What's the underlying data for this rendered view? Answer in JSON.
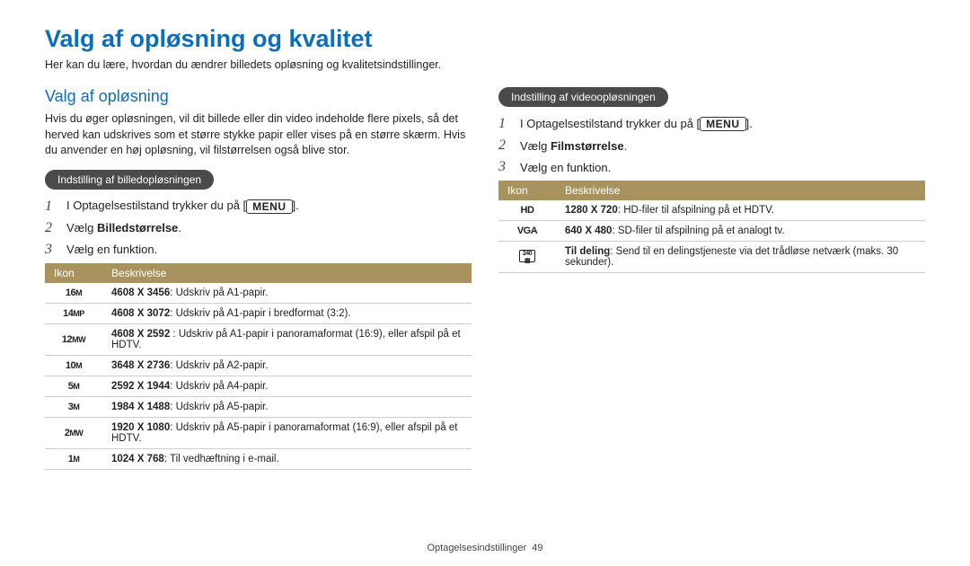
{
  "page": {
    "title": "Valg af opløsning og kvalitet",
    "intro": "Her kan du lære, hvordan du ændrer billedets opløsning og kvalitetsindstillinger."
  },
  "left": {
    "section_title": "Valg af opløsning",
    "section_body": "Hvis du øger opløsningen, vil dit billede eller din video indeholde flere pixels, så det herved kan udskrives som et større stykke papir eller vises på en større skærm. Hvis du anvender en høj opløsning, vil filstørrelsen også blive stor.",
    "pill": "Indstilling af billedopløsningen",
    "steps": [
      {
        "num": "1",
        "pre": "I Optagelsestilstand trykker du på [",
        "btn": "MENU",
        "post": "]."
      },
      {
        "num": "2",
        "pre": "Vælg ",
        "bold": "Billedstørrelse",
        "post": "."
      },
      {
        "num": "3",
        "pre": "Vælg en funktion.",
        "bold": "",
        "post": ""
      }
    ],
    "table": {
      "headers": [
        "Ikon",
        "Beskrivelse"
      ],
      "rows": [
        {
          "icon": "16M",
          "res": "4608 X 3456",
          "desc": ": Udskriv på A1-papir."
        },
        {
          "icon": "14MP",
          "res": "4608 X 3072",
          "desc": ": Udskriv på A1-papir i bredformat (3:2)."
        },
        {
          "icon": "12MW",
          "res": "4608 X 2592",
          "desc": " : Udskriv på A1-papir i panoramaformat (16:9), eller afspil på et HDTV."
        },
        {
          "icon": "10M",
          "res": "3648 X 2736",
          "desc": ": Udskriv på A2-papir."
        },
        {
          "icon": "5M",
          "res": "2592 X 1944",
          "desc": ": Udskriv på A4-papir."
        },
        {
          "icon": "3M",
          "res": "1984 X 1488",
          "desc": ": Udskriv på A5-papir."
        },
        {
          "icon": "2MW",
          "res": "1920 X 1080",
          "desc": ": Udskriv på A5-papir i panoramaformat (16:9), eller afspil på et HDTV."
        },
        {
          "icon": "1M",
          "res": "1024 X 768",
          "desc": ": Til vedhæftning i e-mail."
        }
      ]
    }
  },
  "right": {
    "pill": "Indstilling af videoopløsningen",
    "steps": [
      {
        "num": "1",
        "pre": "I Optagelsestilstand trykker du på [",
        "btn": "MENU",
        "post": "]."
      },
      {
        "num": "2",
        "pre": "Vælg ",
        "bold": "Filmstørrelse",
        "post": "."
      },
      {
        "num": "3",
        "pre": "Vælg en funktion.",
        "bold": "",
        "post": ""
      }
    ],
    "table": {
      "headers": [
        "Ikon",
        "Beskrivelse"
      ],
      "rows": [
        {
          "icon": "HD",
          "res": "1280 X 720",
          "desc": ": HD-filer til afspilning på et HDTV."
        },
        {
          "icon": "VGA",
          "res": "640 X 480",
          "desc": ": SD-filer til afspilning på et analogt tv."
        },
        {
          "icon": "SHARE",
          "res": "Til deling",
          "desc": ": Send til en delingstjeneste via det trådløse netværk (maks. 30 sekunder)."
        }
      ]
    }
  },
  "footer": {
    "section": "Optagelsesindstillinger",
    "page": "49"
  }
}
